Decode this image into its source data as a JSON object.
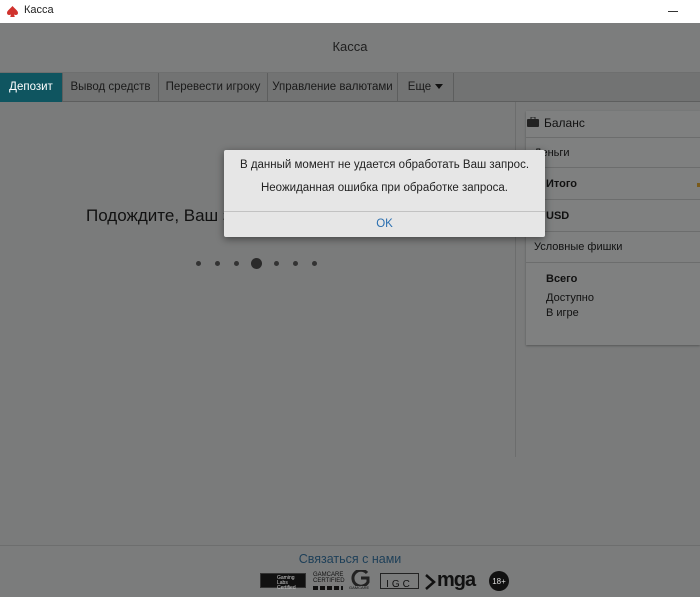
{
  "window": {
    "title": "Касса",
    "icon": "spade-icon"
  },
  "header": {
    "title": "Касса"
  },
  "tabs": [
    {
      "label": "Депозит",
      "active": true
    },
    {
      "label": "Вывод средств",
      "active": false
    },
    {
      "label": "Перевести игроку",
      "active": false
    },
    {
      "label": "Управление валютами",
      "active": false
    },
    {
      "label": "Еще",
      "active": false,
      "icon": "caret-down-icon"
    }
  ],
  "main": {
    "waiting_text": "Подождите, Ваш з"
  },
  "balance": {
    "title": "Баланс",
    "icon": "briefcase-icon",
    "money_label": "Деньги",
    "total_label": "Итого",
    "currency": "USD",
    "chips_label": "Условные фишки",
    "all_label": "Всего",
    "available_label": "Доступно",
    "in_game_label": "В игре"
  },
  "footer": {
    "contact_label": "Связаться с нами",
    "logos": [
      "Gaming Labs Certified",
      "GAMCARE CERTIFIED",
      "GAMCARE",
      "IGC",
      "mga",
      "18+"
    ]
  },
  "dialog": {
    "message_line1": "В данный момент не удается обработать Ваш запрос.",
    "message_line2": "Неожиданная ошибка при обработке запроса.",
    "ok_label": "OK"
  },
  "colors": {
    "active_tab": "#0f5560",
    "overlay_bg": "#7a7b7b",
    "link": "#2a6fb0"
  }
}
